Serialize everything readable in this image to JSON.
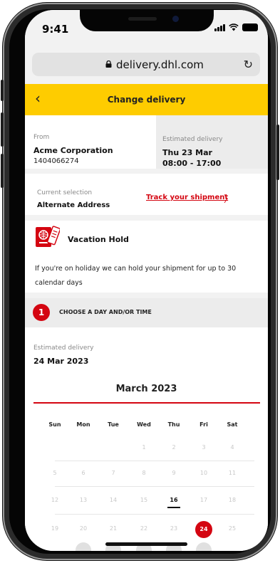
{
  "status": {
    "time": "9:41"
  },
  "browser": {
    "url": "delivery.dhl.com"
  },
  "header": {
    "title": "Change delivery"
  },
  "shipment": {
    "from_label": "From",
    "from_name": "Acme Corporation",
    "tracking_number": "1404066274",
    "est_label": "Estimated delivery",
    "est_day": "Thu 23 Mar",
    "est_window": "08:00 - 17:00"
  },
  "selection": {
    "label": "Current selection",
    "value": "Alternate Address",
    "track_link": "Track your shipment"
  },
  "vacation": {
    "title": "Vacation Hold",
    "description": "If you're on holiday we can hold your shipment for up to 30 calendar days"
  },
  "step": {
    "number": "1",
    "label": "CHOOSE A DAY AND/OR TIME"
  },
  "calendar": {
    "est_label": "Estimated delivery",
    "est_date": "24 Mar 2023",
    "month": "March 2023",
    "weekdays": [
      "Sun",
      "Mon",
      "Tue",
      "Wed",
      "Thu",
      "Fri",
      "Sat"
    ],
    "weeks": [
      [
        "",
        "",
        "",
        "1",
        "2",
        "3",
        "4"
      ],
      [
        "5",
        "6",
        "7",
        "8",
        "9",
        "10",
        "11"
      ],
      [
        "12",
        "13",
        "14",
        "15",
        "16",
        "17",
        "18"
      ],
      [
        "19",
        "20",
        "21",
        "22",
        "23",
        "24",
        "25"
      ]
    ],
    "today": "16",
    "selected": "24",
    "colors": {
      "accent": "#d40511",
      "brand_yellow": "#fecc00"
    }
  }
}
